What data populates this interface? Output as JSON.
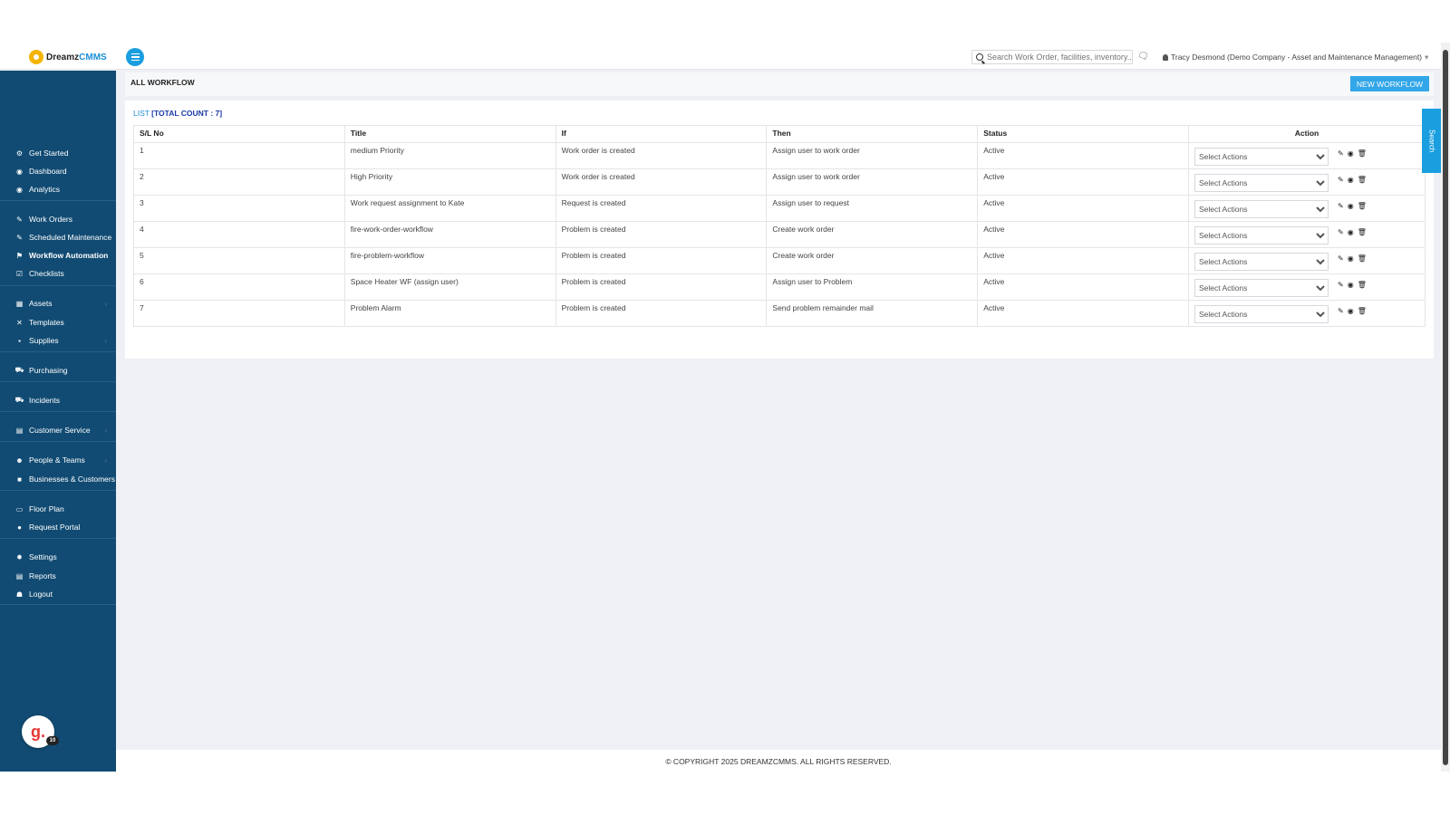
{
  "header": {
    "logo_prefix": "Dreamz",
    "logo_accent": "CMMS",
    "search_placeholder": "Search Work Order, facilities, inventory...",
    "user": "Tracy Desmond (Demo Company - Asset and Maintenance Management)"
  },
  "sidebar": {
    "items": [
      {
        "label": "Get Started",
        "icon": "cogs-icon",
        "glyph": "⚙"
      },
      {
        "label": "Dashboard",
        "icon": "dashboard-icon",
        "glyph": "◉"
      },
      {
        "label": "Analytics",
        "icon": "analytics-icon",
        "glyph": "◉"
      },
      {
        "label": "Work Orders",
        "icon": "wrench-icon",
        "glyph": "✎"
      },
      {
        "label": "Scheduled Maintenance",
        "icon": "wrench-icon",
        "glyph": "✎"
      },
      {
        "label": "Workflow Automation",
        "icon": "flag-icon",
        "glyph": "⚑"
      },
      {
        "label": "Checklists",
        "icon": "checkbox-icon",
        "glyph": "☑"
      },
      {
        "label": "Assets",
        "icon": "table-icon",
        "glyph": "▦"
      },
      {
        "label": "Templates",
        "icon": "random-icon",
        "glyph": "✕"
      },
      {
        "label": "Supplies",
        "icon": "briefcase-icon",
        "glyph": "▪"
      },
      {
        "label": "Purchasing",
        "icon": "cart-icon",
        "glyph": "⛟"
      },
      {
        "label": "Incidents",
        "icon": "cart-icon",
        "glyph": "⛟"
      },
      {
        "label": "Customer Service",
        "icon": "file-icon",
        "glyph": "▤"
      },
      {
        "label": "People & Teams",
        "icon": "users-icon",
        "glyph": "☻"
      },
      {
        "label": "Businesses & Customers",
        "icon": "video-icon",
        "glyph": "■"
      },
      {
        "label": "Floor Plan",
        "icon": "print-icon",
        "glyph": "▭"
      },
      {
        "label": "Request Portal",
        "icon": "comment-icon",
        "glyph": "●"
      },
      {
        "label": "Settings",
        "icon": "gear-icon",
        "glyph": "✹"
      },
      {
        "label": "Reports",
        "icon": "file-icon",
        "glyph": "▤"
      },
      {
        "label": "Logout",
        "icon": "user-icon",
        "glyph": "☗"
      }
    ],
    "badge_letter": "g.",
    "badge_count": "10"
  },
  "page": {
    "title": "ALL WORKFLOW",
    "new_button": "NEW WORKFLOW",
    "list_label": "LIST",
    "total_count": "[TOTAL COUNT : 7]"
  },
  "table": {
    "headers": [
      "S/L No",
      "Title",
      "If",
      "Then",
      "Status",
      "Action"
    ],
    "select_label": "Select Actions",
    "rows": [
      {
        "no": "1",
        "title": "medium Priority",
        "if": "Work order is created",
        "then": "Assign user to work order",
        "status": "Active"
      },
      {
        "no": "2",
        "title": "High Priority",
        "if": "Work order is created",
        "then": "Assign user to work order",
        "status": "Active"
      },
      {
        "no": "3",
        "title": "Work request assignment to Kate",
        "if": "Request is created",
        "then": "Assign user to request",
        "status": "Active"
      },
      {
        "no": "4",
        "title": "fire-work-order-workflow",
        "if": "Problem is created",
        "then": "Create work order",
        "status": "Active"
      },
      {
        "no": "5",
        "title": "fire-problem-workflow",
        "if": "Problem is created",
        "then": "Create work order",
        "status": "Active"
      },
      {
        "no": "6",
        "title": "Space Heater WF (assign user)",
        "if": "Problem is created",
        "then": "Assign user to Problem",
        "status": "Active"
      },
      {
        "no": "7",
        "title": "Problem Alarm",
        "if": "Problem is created",
        "then": "Send problem remainder mail",
        "status": "Active"
      }
    ]
  },
  "side_search": "Search",
  "footer": "© COPYRIGHT 2025 DREAMZCMMS. ALL RIGHTS RESERVED."
}
